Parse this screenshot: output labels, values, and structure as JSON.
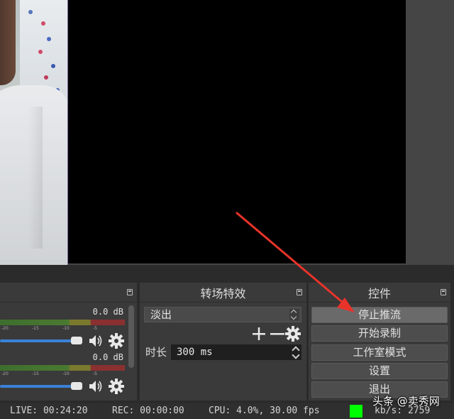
{
  "mixer": {
    "channels": [
      {
        "db": "0.0 dB"
      },
      {
        "db": "0.0 dB"
      }
    ],
    "ticks": [
      "-20",
      "-15",
      "-10",
      "-5"
    ]
  },
  "transitions": {
    "title": "转场特效",
    "selected": "淡出",
    "duration_label": "时长",
    "duration_value": "300 ms"
  },
  "controls": {
    "title": "控件",
    "stop_stream": "停止推流",
    "start_record": "开始录制",
    "studio_mode": "工作室模式",
    "settings": "设置",
    "exit": "退出"
  },
  "status": {
    "live": "LIVE: 00:24:20",
    "rec": "REC: 00:00:00",
    "cpu": "CPU: 4.0%, 30.00 fps",
    "kbps": "kb/s: 2759",
    "indicator_color": "#00ff00"
  },
  "watermark": "头条 @卖秀网",
  "annotation": {
    "arrow_color": "#e8332a"
  }
}
